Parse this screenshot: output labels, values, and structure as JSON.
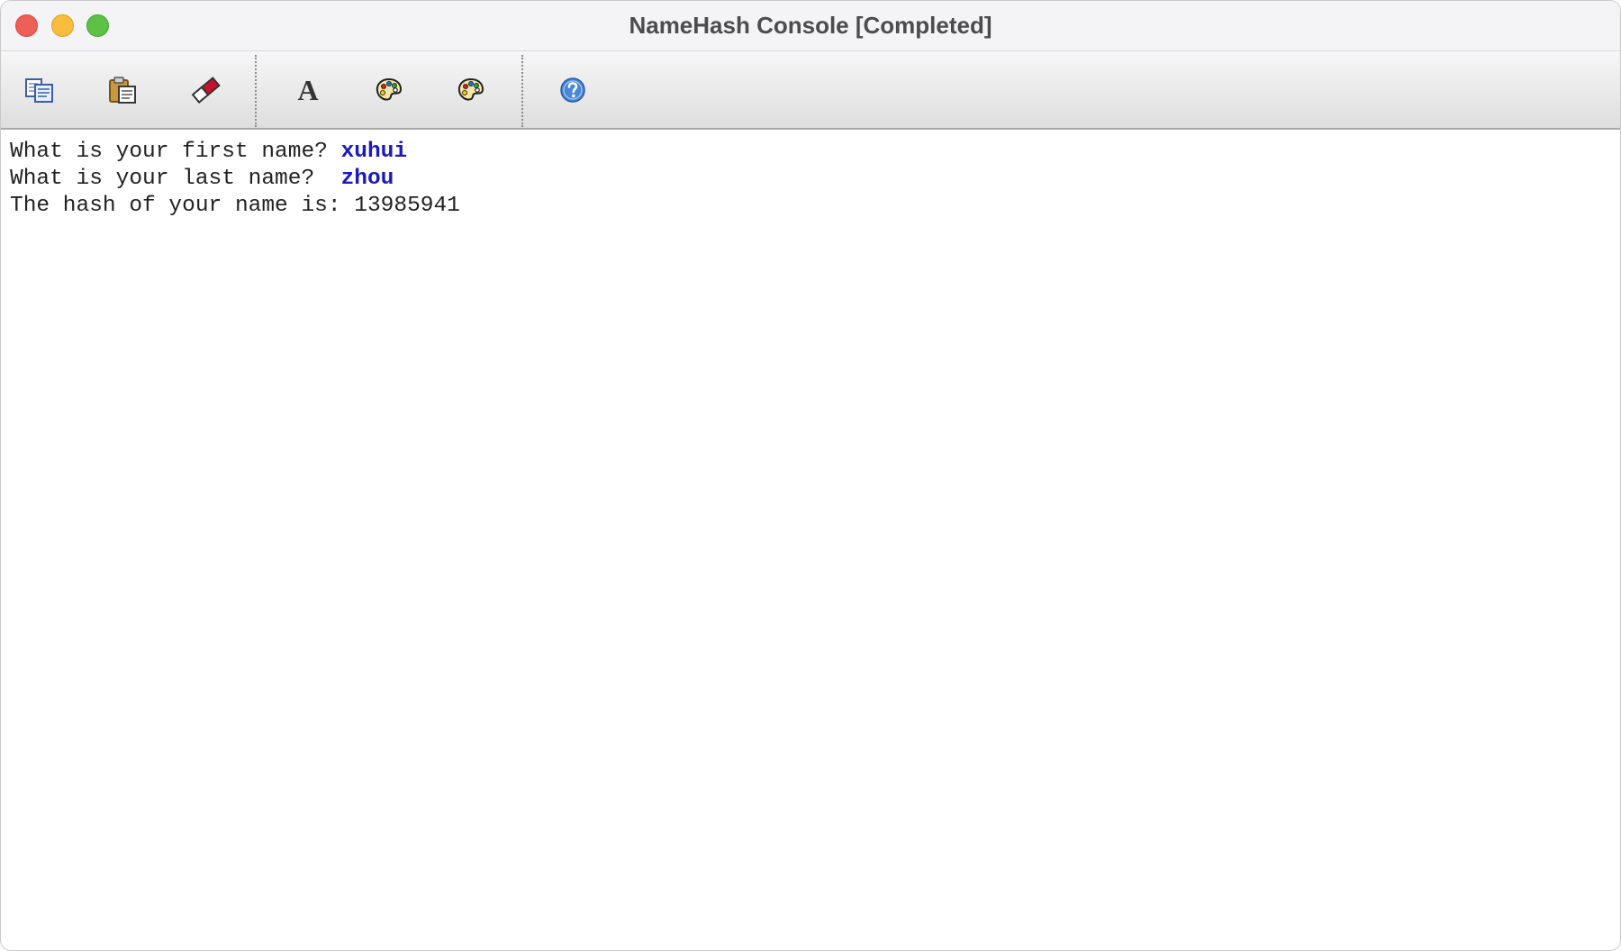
{
  "window": {
    "title": "NameHash Console [Completed]"
  },
  "toolbar": {
    "buttons": [
      {
        "name": "copy",
        "icon": "copy-icon"
      },
      {
        "name": "paste",
        "icon": "paste-icon"
      },
      {
        "name": "clear",
        "icon": "eraser-icon"
      },
      {
        "name": "font",
        "icon": "font-icon",
        "glyph": "A"
      },
      {
        "name": "text-color",
        "icon": "palette-icon"
      },
      {
        "name": "background-color",
        "icon": "palette-icon"
      },
      {
        "name": "help",
        "icon": "help-icon"
      }
    ]
  },
  "console": {
    "lines": [
      {
        "prompt": "What is your first name? ",
        "input": "xuhui"
      },
      {
        "prompt": "What is your last name?  ",
        "input": "zhou"
      },
      {
        "prompt": "The hash of your name is: 13985941",
        "input": ""
      }
    ]
  },
  "colors": {
    "input_text": "#1b1bbd",
    "output_text": "#222222",
    "close": "#ee5f58",
    "minimize": "#f8bd3c",
    "zoom": "#5cc145"
  }
}
